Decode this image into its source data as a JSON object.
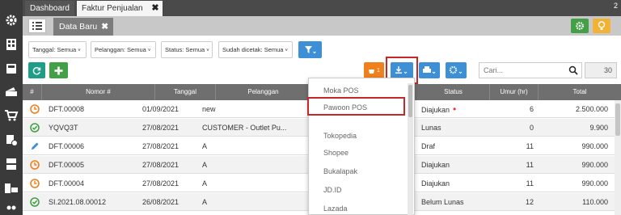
{
  "tabs": [
    {
      "label": "Dashboard",
      "active": false
    },
    {
      "label": "Faktur Penjualan",
      "active": true
    }
  ],
  "tab_close": "✖",
  "topbar_number": "2",
  "subheader": {
    "tab_label": "Data Baru",
    "tab_close": "✖"
  },
  "filters": [
    {
      "label": "Tanggal: Semua"
    },
    {
      "label": "Pelanggan: Semua"
    },
    {
      "label": "Status: Semua"
    },
    {
      "label": "Sudah dicetak: Semua"
    }
  ],
  "badge_count": "1",
  "search": {
    "placeholder": "Cari..."
  },
  "page_count": "30",
  "table": {
    "headers": {
      "flag": "#",
      "nomor": "Nomor #",
      "tanggal": "Tanggal",
      "pelanggan": "Pelanggan",
      "status": "Status",
      "umur": "Umur (hr)",
      "total": "Total"
    },
    "rows": [
      {
        "icon": "clock-icon",
        "nomor": "DFT.00008",
        "tanggal": "01/09/2021",
        "pelanggan": "new",
        "status": "Diajukan",
        "umur": "6",
        "total": "2.500.000",
        "dot": true
      },
      {
        "icon": "check-circle-icon",
        "nomor": "YQVQ3T",
        "tanggal": "27/08/2021",
        "pelanggan": "CUSTOMER - Outlet Pu...",
        "status": "Lunas",
        "umur": "0",
        "total": "9.900",
        "dot": false
      },
      {
        "icon": "pencil-icon",
        "nomor": "DFT.00006",
        "tanggal": "27/08/2021",
        "pelanggan": "A",
        "status": "Draf",
        "umur": "11",
        "total": "990.000",
        "dot": false
      },
      {
        "icon": "clock-icon",
        "nomor": "DFT.00005",
        "tanggal": "27/08/2021",
        "pelanggan": "A",
        "status": "Diajukan",
        "umur": "11",
        "total": "990.000",
        "dot": false
      },
      {
        "icon": "clock-icon",
        "nomor": "DFT.00004",
        "tanggal": "27/08/2021",
        "pelanggan": "A",
        "status": "Diajukan",
        "umur": "11",
        "total": "990.000",
        "dot": false
      },
      {
        "icon": "check-circle-icon",
        "nomor": "SI.2021.08.00012",
        "tanggal": "26/08/2021",
        "pelanggan": "A",
        "status": "Belum Lunas",
        "umur": "12",
        "total": "110.000",
        "dot": false
      }
    ]
  },
  "import_menu": {
    "items": [
      "Moka POS",
      "Pawoon POS",
      "Tokopedia",
      "Shopee",
      "Bukalapak",
      "JD.ID",
      "Lazada"
    ],
    "highlighted": "Pawoon POS"
  },
  "colors": {
    "green": "#43a047",
    "teal": "#1e9e86",
    "blue": "#3d8fd6",
    "orange": "#f0801c",
    "yellow": "#f2b233",
    "highlight_red": "#c62828"
  }
}
